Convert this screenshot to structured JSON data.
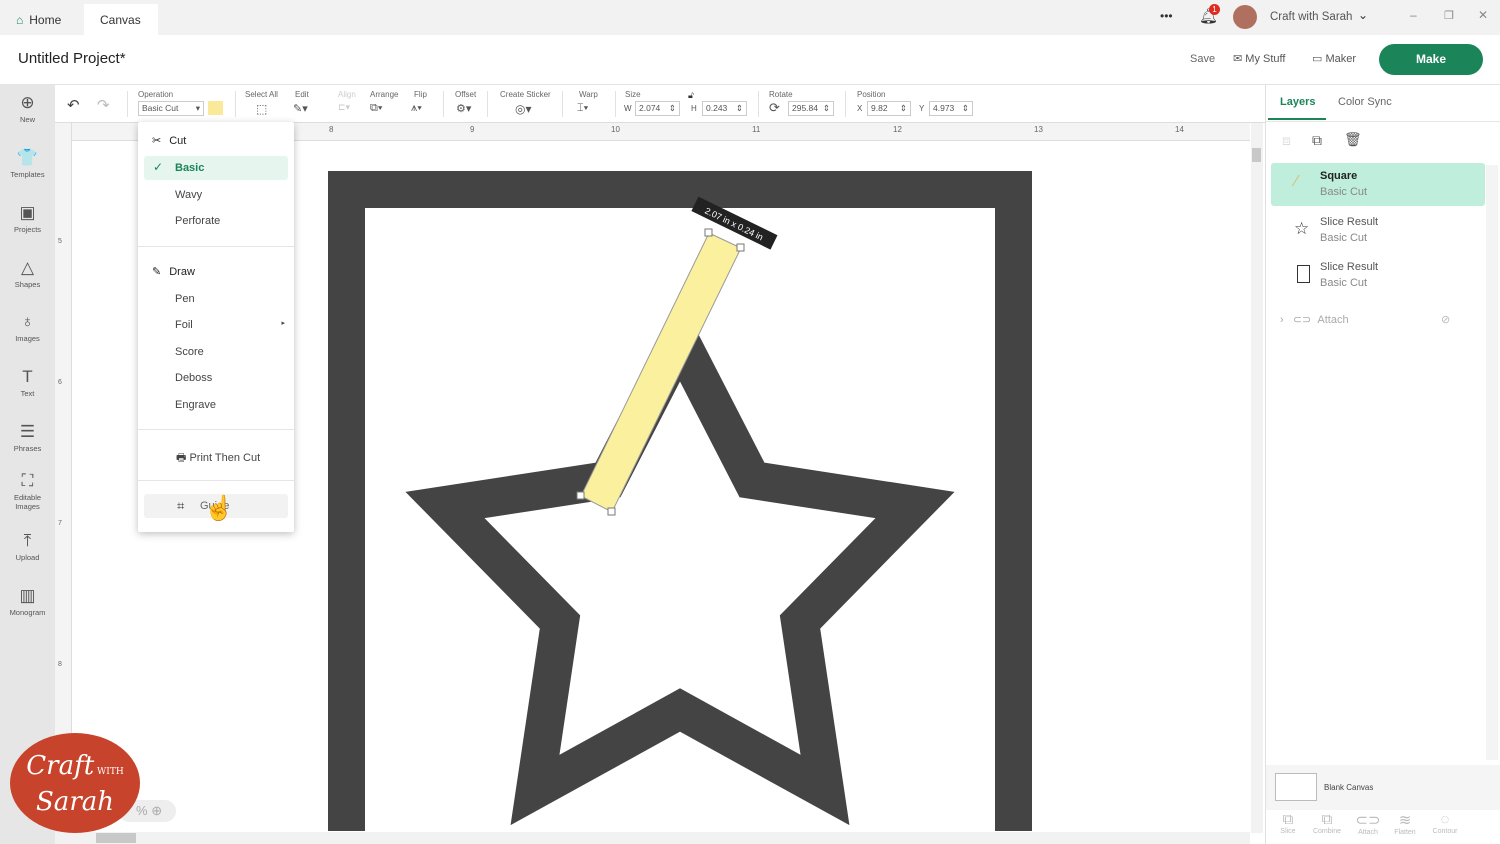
{
  "topbar": {
    "tabs": [
      {
        "label": "Home"
      },
      {
        "label": "Canvas"
      }
    ],
    "more": "•••",
    "notification_count": "1",
    "user": "Craft with Sarah"
  },
  "header": {
    "title": "Untitled Project*",
    "save": "Save",
    "my_stuff": "My Stuff",
    "maker": "Maker",
    "make": "Make"
  },
  "toolbar": {
    "operation_label": "Operation",
    "operation_value": "Basic Cut",
    "swatch_color": "#fbe99a",
    "select_all": "Select All",
    "edit": "Edit",
    "align": "Align",
    "arrange": "Arrange",
    "flip": "Flip",
    "offset": "Offset",
    "create_sticker": "Create Sticker",
    "warp": "Warp",
    "size": "Size",
    "w_label": "W",
    "w": "2.074",
    "h_label": "H",
    "h": "0.243",
    "rotate": "Rotate",
    "rotate_value": "295.84",
    "position": "Position",
    "x_label": "X",
    "x": "9.82",
    "y_label": "Y",
    "y": "4.973"
  },
  "sidebar": [
    {
      "label": "New",
      "icon": "⊕"
    },
    {
      "label": "Templates",
      "icon": "👕"
    },
    {
      "label": "Projects",
      "icon": "▣"
    },
    {
      "label": "Shapes",
      "icon": "△"
    },
    {
      "label": "Images",
      "icon": "♁"
    },
    {
      "label": "Text",
      "icon": "T"
    },
    {
      "label": "Phrases",
      "icon": "☰"
    },
    {
      "label": "Editable Images",
      "icon": "⛶"
    },
    {
      "label": "Upload",
      "icon": "⤒"
    },
    {
      "label": "Monogram",
      "icon": "▥"
    }
  ],
  "ruler": {
    "top": [
      "8",
      "9",
      "10",
      "11",
      "12",
      "13",
      "14"
    ],
    "left": [
      "5",
      "6",
      "7",
      "8"
    ]
  },
  "menu": {
    "cut": "Cut",
    "basic": "Basic",
    "wavy": "Wavy",
    "perforate": "Perforate",
    "draw": "Draw",
    "pen": "Pen",
    "foil": "Foil",
    "score": "Score",
    "deboss": "Deboss",
    "engrave": "Engrave",
    "print_then_cut": "Print Then Cut",
    "guide": "Guide"
  },
  "canvas": {
    "dimension_label": "2.07 in x 0.24 in",
    "zoom": "%",
    "frame_color": "#444444",
    "selected_color": "#fbf09e"
  },
  "panel": {
    "tabs": [
      {
        "label": "Layers"
      },
      {
        "label": "Color Sync"
      }
    ],
    "layers": [
      {
        "name": "Square",
        "op": "Basic Cut"
      },
      {
        "name": "Slice Result",
        "op": "Basic Cut"
      },
      {
        "name": "Slice Result",
        "op": "Basic Cut"
      }
    ],
    "attach": "Attach",
    "blank_canvas": "Blank Canvas",
    "bottom": [
      {
        "label": "Slice",
        "icon": "⧉"
      },
      {
        "label": "Combine",
        "icon": "⧉"
      },
      {
        "label": "Attach",
        "icon": "⊂⊃"
      },
      {
        "label": "Flatten",
        "icon": "≋"
      },
      {
        "label": "Contour",
        "icon": "◌"
      }
    ]
  },
  "watermark": {
    "text": "Craft with Sarah",
    "color": "#c8432b"
  }
}
